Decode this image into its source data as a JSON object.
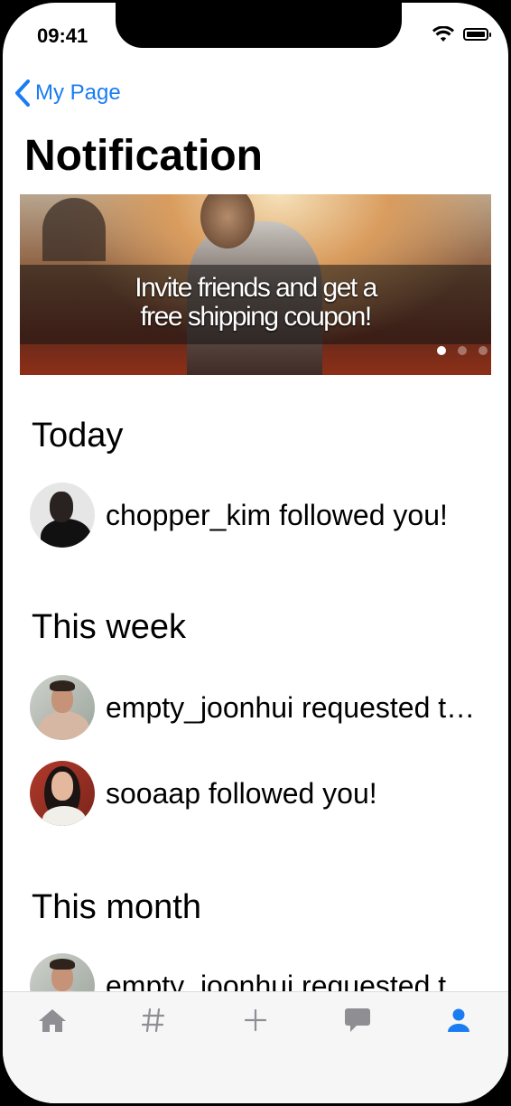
{
  "status_bar": {
    "time": "09:41"
  },
  "nav": {
    "back_label": "My Page"
  },
  "page": {
    "title": "Notification"
  },
  "banner": {
    "line1": "Invite friends and get a",
    "line2": "free shipping coupon!",
    "page_count": 3,
    "active_page": 1
  },
  "sections": [
    {
      "title": "Today",
      "items": [
        {
          "text": "chopper_kim followed you!"
        }
      ]
    },
    {
      "title": "This week",
      "items": [
        {
          "text": "empty_joonhui requested to follow you."
        },
        {
          "text": "sooaap followed you!"
        }
      ]
    },
    {
      "title": "This month",
      "items": [
        {
          "text": "empty_joonhui requested to follow you."
        }
      ]
    }
  ],
  "tabbar": {
    "tabs": [
      {
        "icon": "home-icon",
        "active": false
      },
      {
        "icon": "hashtag-icon",
        "active": false
      },
      {
        "icon": "plus-icon",
        "active": false
      },
      {
        "icon": "chat-bubble-icon",
        "active": false
      },
      {
        "icon": "person-icon",
        "active": true
      }
    ],
    "active_color": "#1a7cf2",
    "inactive_color": "#8e8e93"
  },
  "colors": {
    "accent": "#1a7cf2"
  }
}
